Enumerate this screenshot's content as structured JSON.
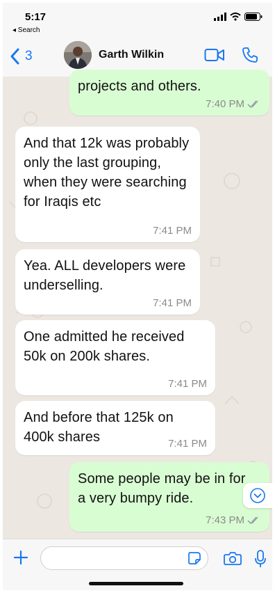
{
  "status_bar": {
    "time": "5:17",
    "back_app": "◂ Search"
  },
  "header": {
    "back_count": "3",
    "contact_name": "Garth Wilkin",
    "accent_color": "#1877f2"
  },
  "messages": [
    {
      "direction": "out",
      "text": "projects and others.",
      "time": "7:40 PM",
      "read": true
    },
    {
      "direction": "in",
      "text": "And that 12k was probably only the last grouping, when they were searching for Iraqis etc",
      "time": "7:41 PM"
    },
    {
      "direction": "in",
      "text": "Yea. ALL developers were underselling.",
      "time": "7:41 PM"
    },
    {
      "direction": "in",
      "text": "One admitted he received 50k on 200k shares.",
      "time": "7:41 PM"
    },
    {
      "direction": "in",
      "text": "And before that 125k on 400k shares",
      "time": "7:41 PM"
    },
    {
      "direction": "out",
      "text": "Some people may be in for a very bumpy ride.",
      "time": "7:43 PM",
      "read": true
    }
  ],
  "input": {
    "value": "",
    "placeholder": ""
  },
  "colors": {
    "outgoing_bubble": "#d9fdd3",
    "incoming_bubble": "#ffffff",
    "chat_background": "#ece7e0",
    "read_ticks": "#9aa0a6"
  },
  "icons": {
    "back": "chevron-left-icon",
    "video": "video-camera-icon",
    "call": "phone-icon",
    "scroll_down": "chevron-down-circle-icon",
    "attach": "plus-icon",
    "sticker": "sticker-icon",
    "camera": "camera-icon",
    "mic": "microphone-icon"
  }
}
